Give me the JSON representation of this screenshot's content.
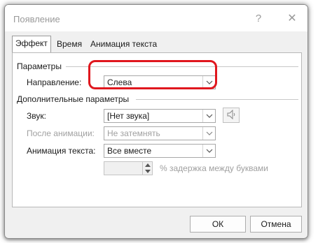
{
  "window": {
    "title": "Появление",
    "help_label": "?",
    "close_label": "✕"
  },
  "tabs": [
    {
      "label": "Эффект",
      "active": true
    },
    {
      "label": "Время",
      "active": false
    },
    {
      "label": "Анимация текста",
      "active": false
    }
  ],
  "parameters": {
    "section_label": "Параметры",
    "direction_label": "Направление:",
    "direction_value": "Слева"
  },
  "extra": {
    "section_label": "Дополнительные параметры",
    "sound_label": "Звук:",
    "sound_value": "[Нет звука]",
    "sound_icon": "speaker-icon",
    "after_label": "После анимации:",
    "after_value": "Не затемнять",
    "text_anim_label": "Анимация текста:",
    "text_anim_value": "Все вместе",
    "delay_value": "",
    "delay_label": "% задержка между буквами"
  },
  "footer": {
    "ok_label": "ОК",
    "cancel_label": "Отмена"
  },
  "colors": {
    "highlight": "#e0171e",
    "dialog_bg": "#f0f0f0"
  }
}
